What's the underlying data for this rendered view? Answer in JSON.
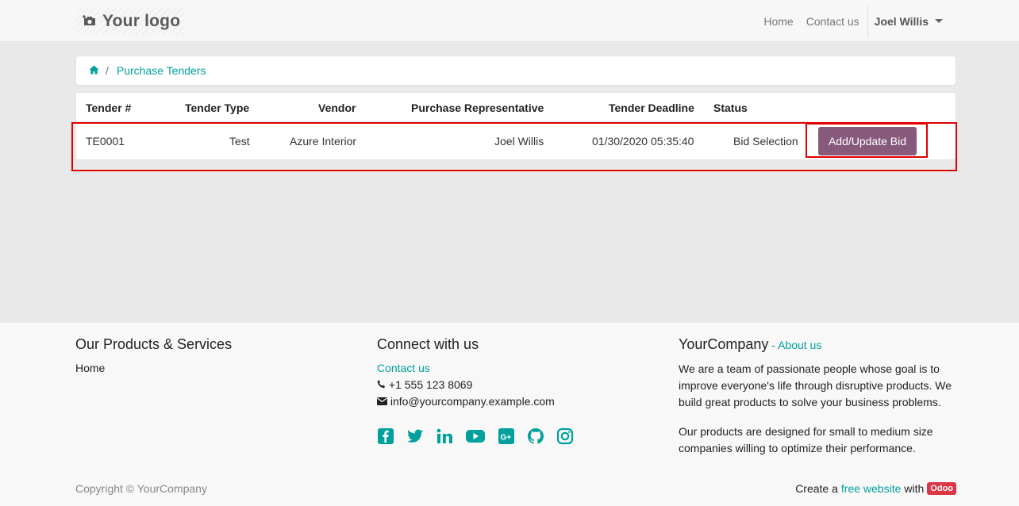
{
  "navbar": {
    "logo_text": "Your logo",
    "links": [
      "Home",
      "Contact us"
    ],
    "user": "Joel Willis"
  },
  "breadcrumb": {
    "home_icon": "home-icon",
    "current": "Purchase Tenders"
  },
  "table": {
    "headers": [
      "Tender #",
      "Tender Type",
      "Vendor",
      "Purchase Representative",
      "Tender Deadline",
      "Status"
    ],
    "rows": [
      {
        "tender_no": "TE0001",
        "type": "Test",
        "vendor": "Azure Interior",
        "representative": "Joel Willis",
        "deadline": "01/30/2020 05:35:40",
        "status": "Bid Selection",
        "action_label": "Add/Update Bid"
      }
    ]
  },
  "footer": {
    "products_heading": "Our Products & Services",
    "products_link": "Home",
    "connect_heading": "Connect with us",
    "contact_link": "Contact us",
    "phone": "+1 555 123 8069",
    "email": "info@yourcompany.example.com",
    "social_icons": [
      "facebook-icon",
      "twitter-icon",
      "linkedin-icon",
      "youtube-icon",
      "google-plus-icon",
      "github-icon",
      "instagram-icon"
    ],
    "company_name": "YourCompany",
    "company_sep": " - ",
    "about_link": "About us",
    "about_p1": "We are a team of passionate people whose goal is to improve everyone's life through disruptive products. We build great products to solve your business problems.",
    "about_p2": "Our products are designed for small to medium size companies willing to optimize their performance.",
    "copyright": "Copyright © YourCompany",
    "credit_prefix": "Create a",
    "credit_link": "free website",
    "credit_with": "with",
    "credit_badge": "Odoo"
  },
  "colors": {
    "accent": "#00a09d",
    "button": "#875a7b",
    "highlight": "#e00000"
  }
}
